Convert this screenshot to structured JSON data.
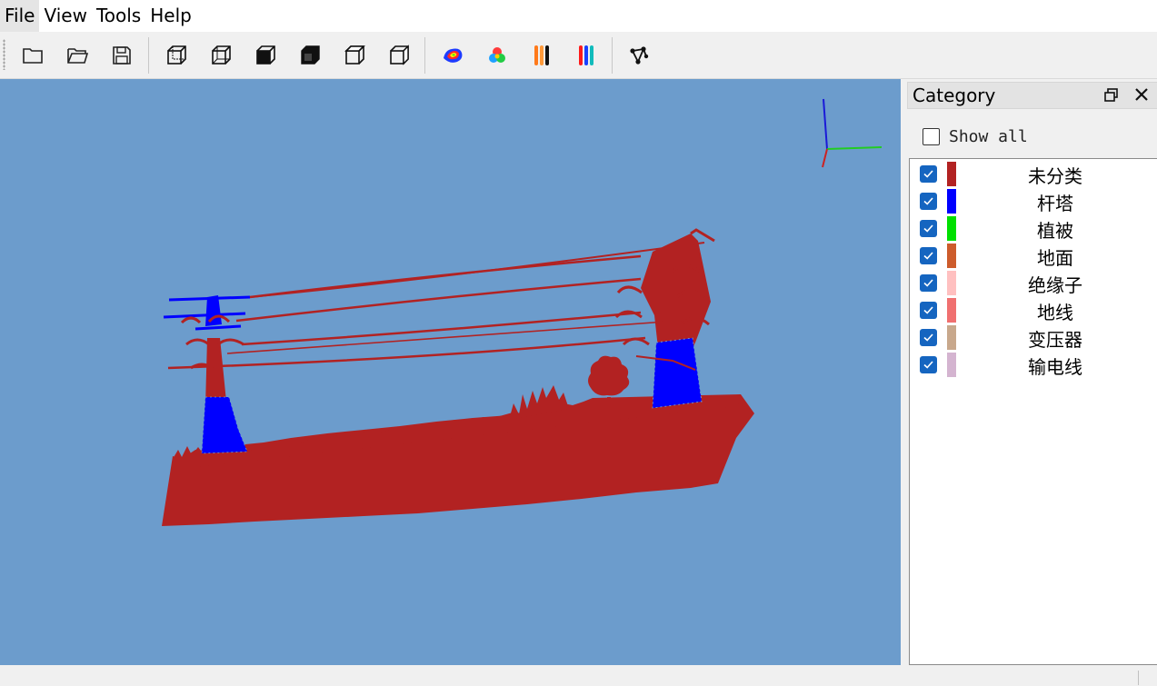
{
  "menu": {
    "file": "File",
    "view": "View",
    "tools": "Tools",
    "help": "Help"
  },
  "toolbar": {
    "buttons": [
      "new-folder-icon",
      "open-folder-icon",
      "save-icon",
      "front-view-icon",
      "back-view-icon",
      "left-view-icon",
      "right-view-icon",
      "top-view-icon",
      "bottom-view-icon",
      "height-color-icon",
      "class-color-icon",
      "ramp-color-icon",
      "rgb-color-icon",
      "graph-icon"
    ]
  },
  "viewport": {
    "background_color": "#6c9ccc",
    "axes_colors": {
      "x": "#22cc22",
      "y": "#cc2222",
      "z": "#1a1ad8"
    }
  },
  "category_panel": {
    "title": "Category",
    "show_all_label": "Show all",
    "show_all_checked": false,
    "categories": [
      {
        "label": "未分类",
        "color": "#b22222",
        "checked": true
      },
      {
        "label": "杆塔",
        "color": "#0000ff",
        "checked": true
      },
      {
        "label": "植被",
        "color": "#00e000",
        "checked": true
      },
      {
        "label": "地面",
        "color": "#cd5c2c",
        "checked": true
      },
      {
        "label": "绝缘子",
        "color": "#ffc0c0",
        "checked": true
      },
      {
        "label": "地线",
        "color": "#f07070",
        "checked": true
      },
      {
        "label": "变压器",
        "color": "#c8a88c",
        "checked": true
      },
      {
        "label": "输电线",
        "color": "#d4b4d0",
        "checked": true
      }
    ]
  }
}
